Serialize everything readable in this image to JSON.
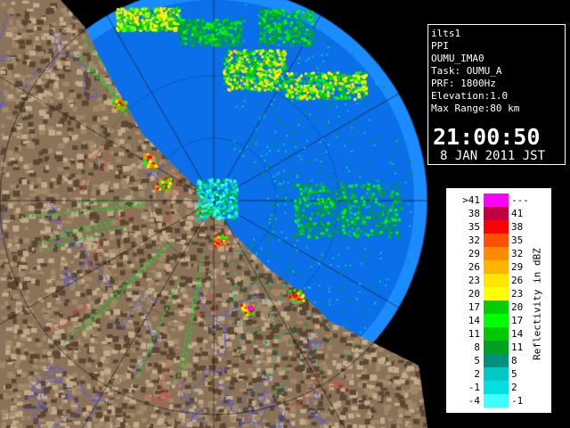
{
  "info_panel": {
    "lines": [
      "ilts1",
      "PPI",
      "OUMU_IMA0",
      "Task: OUMU_A",
      "PRF: 1800Hz",
      "Elevation:1.0",
      "Max Range:80 km"
    ],
    "time": "21:00:50",
    "date": "8 JAN 2011 JST"
  },
  "legend": {
    "title": "Reflectivity in dBZ",
    "left_labels": [
      ">41",
      "38",
      "35",
      "32",
      "29",
      "26",
      "23",
      "20",
      "17",
      "14",
      "11",
      "8",
      "5",
      "2",
      "-1",
      "-4"
    ],
    "right_labels": [
      "---",
      "41",
      "38",
      "35",
      "32",
      "29",
      "26",
      "23",
      "20",
      "17",
      "14",
      "11",
      "8",
      "5",
      "2",
      "-1"
    ],
    "colors": [
      "#ff00ff",
      "#c00040",
      "#ff0000",
      "#ff5000",
      "#ff8c00",
      "#ffb400",
      "#ffe600",
      "#ffff00",
      "#00d000",
      "#00ff00",
      "#00c800",
      "#00a020",
      "#009080",
      "#00c8c8",
      "#00e0e0",
      "#40ffff"
    ]
  },
  "colors": {
    "sea": "#0a6fe8",
    "outer_sea": "#1a8cff",
    "land": "#8a7358",
    "panel_border": "#ffffff"
  }
}
